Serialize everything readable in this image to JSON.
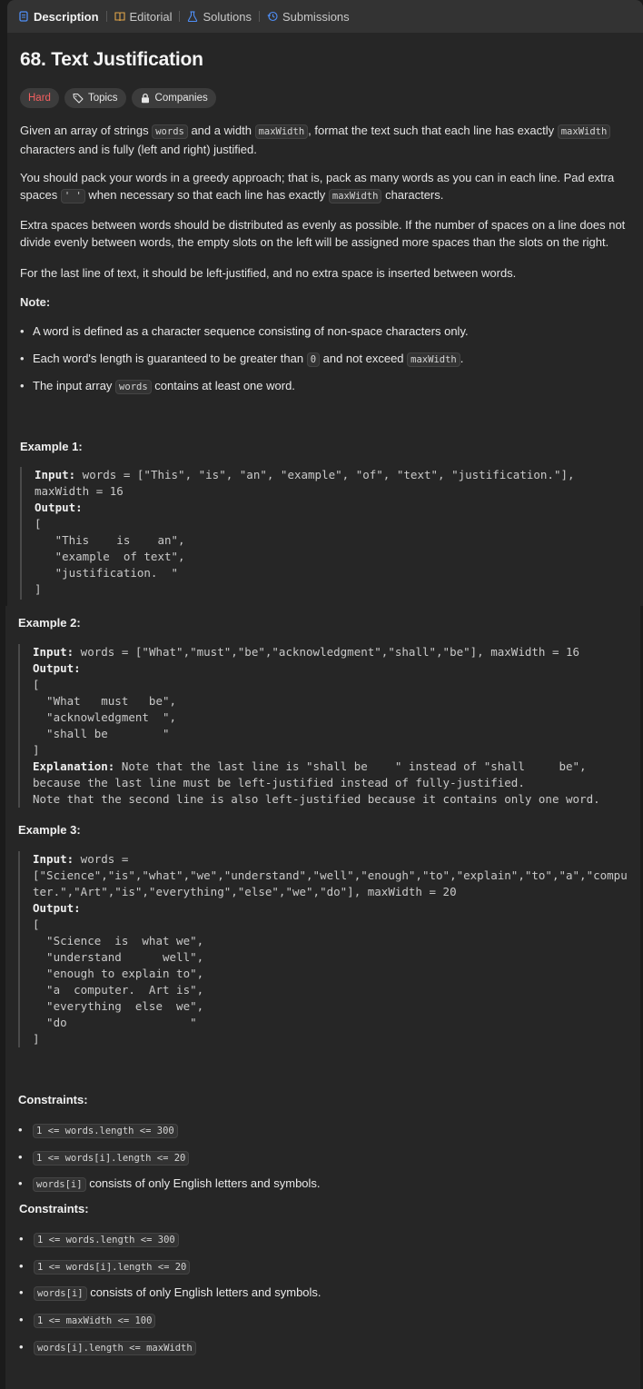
{
  "tabs": [
    {
      "label": "Description",
      "icon": "description-icon",
      "active": true
    },
    {
      "label": "Editorial",
      "icon": "book-icon"
    },
    {
      "label": "Solutions",
      "icon": "flask-icon"
    },
    {
      "label": "Submissions",
      "icon": "history-icon"
    }
  ],
  "problem": {
    "title": "68. Text Justification",
    "difficulty": "Hard",
    "topics_label": "Topics",
    "companies_label": "Companies"
  },
  "paragraphs": {
    "p1a": "Given an array of strings ",
    "p1_code1": "words",
    "p1b": " and a width ",
    "p1_code2": "maxWidth",
    "p1c": ", format the text such that each line has exactly ",
    "p1_code3": "maxWidth",
    "p1d": " characters and is fully (left and right) justified.",
    "p2a": "You should pack your words in a greedy approach; that is, pack as many words as you can in each line. Pad extra spaces ",
    "p2_code1": "' '",
    "p2b": " when necessary so that each line has exactly ",
    "p2_code2": "maxWidth",
    "p2c": " characters.",
    "p3": "Extra spaces between words should be distributed as evenly as possible. If the number of spaces on a line does not divide evenly between words, the empty slots on the left will be assigned more spaces than the slots on the right.",
    "p4": "For the last line of text, it should be left-justified, and no extra space is inserted between words."
  },
  "note": {
    "heading": "Note:",
    "b1": "A word is defined as a character sequence consisting of non-space characters only.",
    "b2a": "Each word's length is guaranteed to be greater than ",
    "b2_code1": "0",
    "b2b": " and not exceed ",
    "b2_code2": "maxWidth",
    "b2c": ".",
    "b3a": "The input array ",
    "b3_code": "words",
    "b3b": " contains at least one word."
  },
  "examples": [
    {
      "heading": "Example 1:",
      "input_label": "Input:",
      "input_line1": " words = [\"This\", \"is\", \"an\", \"example\", \"of\", \"text\", \"justification.\"],",
      "input_line2": "maxWidth = 16",
      "output_label": "Output:",
      "output": "[\n   \"This    is    an\",\n   \"example  of text\",\n   \"justification.  \"\n]"
    },
    {
      "heading": "Example 2:",
      "input_label": "Input:",
      "input_line1": " words = [\"What\",\"must\",\"be\",\"acknowledgment\",\"shall\",\"be\"], maxWidth = 16",
      "output_label": "Output:",
      "output": "[\n  \"What   must   be\",\n  \"acknowledgment  \",\n  \"shall be        \"\n]",
      "explanation_label": "Explanation:",
      "explanation_line1": " Note that the last line is \"shall be    \" instead of \"shall     be\",",
      "explanation_line2": "because the last line must be left-justified instead of fully-justified.",
      "explanation_line3": "Note that the second line is also left-justified because it contains only one word."
    },
    {
      "heading": "Example 3:",
      "input_label": "Input:",
      "input_line1": " words =",
      "input_line2": "[\"Science\",\"is\",\"what\",\"we\",\"understand\",\"well\",\"enough\",\"to\",\"explain\",\"to\",\"a\",\"compu",
      "input_line3": "ter.\",\"Art\",\"is\",\"everything\",\"else\",\"we\",\"do\"], maxWidth = 20",
      "output_label": "Output:",
      "output": "[\n  \"Science  is  what we\",\n  \"understand      well\",\n  \"enough to explain to\",\n  \"a  computer.  Art is\",\n  \"everything  else  we\",\n  \"do                  \"\n]"
    }
  ],
  "constraints_a": {
    "heading": "Constraints:",
    "items": [
      {
        "code": "1 <= words.length <= 300",
        "text": ""
      },
      {
        "code": "1 <= words[i].length <= 20",
        "text": ""
      },
      {
        "code": "words[i]",
        "text": " consists of only English letters and symbols."
      }
    ]
  },
  "constraints_b": {
    "heading": "Constraints:",
    "items": [
      {
        "code": "1 <= words.length <= 300",
        "text": ""
      },
      {
        "code": "1 <= words[i].length <= 20",
        "text": ""
      },
      {
        "code": "words[i]",
        "text": " consists of only English letters and symbols."
      },
      {
        "code": "1 <= maxWidth <= 100",
        "text": ""
      },
      {
        "code": "words[i].length <= maxWidth",
        "text": ""
      }
    ]
  },
  "colors": {
    "hard": "#f36060",
    "background": "#1b1b1b",
    "panel": "#262626",
    "tabbar": "#333333"
  }
}
